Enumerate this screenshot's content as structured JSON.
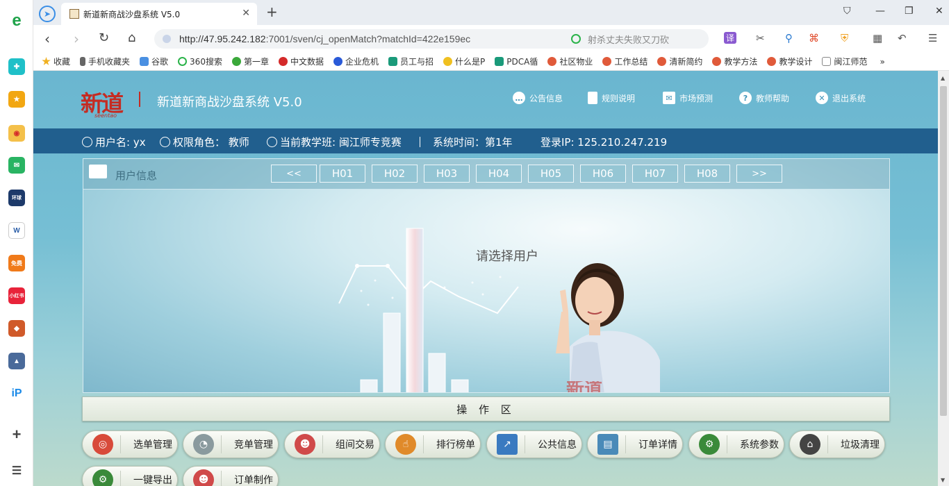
{
  "browser": {
    "tab_title": "新道新商战沙盘系统 V5.0",
    "url_host": "http://47.95.242.182",
    "url_rest": ":7001/sven/cj_openMatch?matchId=422e159ec",
    "search_placeholder": "射杀丈夫失败又刀砍",
    "translate_label": "译"
  },
  "bookmarks": [
    "收藏",
    "手机收藏夹",
    "谷歌",
    "360搜索",
    "第一章",
    "中文数据",
    "企业危机",
    "员工与招",
    "什么是P",
    "PDCA循",
    "社区物业",
    "工作总结",
    "清新简约",
    "教学方法",
    "教学设计",
    "闽江师范"
  ],
  "header": {
    "logo_text": "新道",
    "logo_sub": "seentao",
    "system_title": "新道新商战沙盘系统 V5.0",
    "menu": [
      "公告信息",
      "规则说明",
      "市场预测",
      "教师帮助",
      "退出系统"
    ]
  },
  "infobar": {
    "username": "用户名: yx",
    "role": "权限角色： 教师",
    "class": "当前教学班: 闽江师专竞赛",
    "time": "系统时间：第1年",
    "ip": "登录IP: 125.210.247.219"
  },
  "panel": {
    "title": "用户信息",
    "prev": "<<",
    "next": ">>",
    "users": [
      "H01",
      "H02",
      "H03",
      "H04",
      "H05",
      "H06",
      "H07",
      "H08"
    ],
    "prompt": "请选择用户"
  },
  "opbar": {
    "title": "操 作 区"
  },
  "actions": [
    {
      "label": "选单管理",
      "icon": "target-icon",
      "color": "#d84a3a"
    },
    {
      "label": "竞单管理",
      "icon": "pie-icon",
      "color": "#8a9a9e"
    },
    {
      "label": "组间交易",
      "icon": "people-icon",
      "color": "#d04a4a"
    },
    {
      "label": "排行榜单",
      "icon": "hand-icon",
      "color": "#e08a2a"
    },
    {
      "label": "公共信息",
      "icon": "chart-icon",
      "color": "#3a7ac0"
    },
    {
      "label": "订单详情",
      "icon": "document-icon",
      "color": "#4a8ab8"
    },
    {
      "label": "系统参数",
      "icon": "gear-icon",
      "color": "#3a8a3a"
    },
    {
      "label": "垃圾清理",
      "icon": "cleaner-icon",
      "color": "#444444"
    },
    {
      "label": "一键导出",
      "icon": "gear-icon",
      "color": "#3a8a3a"
    },
    {
      "label": "订单制作",
      "icon": "people-icon",
      "color": "#d04a4a"
    }
  ]
}
